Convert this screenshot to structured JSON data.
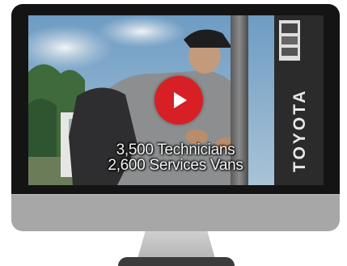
{
  "video": {
    "caption_line1": "3,500 Technicians",
    "caption_line2": "2,600 Services Vans",
    "brand_label": "TOYOTA"
  },
  "colors": {
    "play_button": "#d91f26",
    "bezel": "#141414",
    "chin": "#a7a7a7"
  },
  "icons": {
    "play": "play-icon"
  }
}
